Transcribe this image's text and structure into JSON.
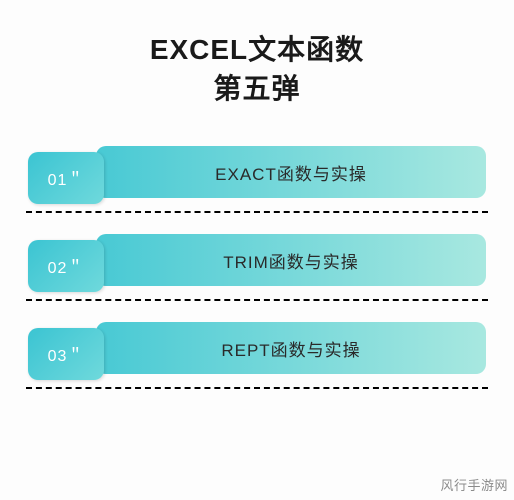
{
  "title": {
    "line1": "EXCEL文本函数",
    "line2": "第五弹"
  },
  "items": [
    {
      "num": "01＂",
      "label": "EXACT函数与实操"
    },
    {
      "num": "02＂",
      "label": "TRIM函数与实操"
    },
    {
      "num": "03＂",
      "label": "REPT函数与实操"
    }
  ],
  "watermark": "风行手游网"
}
